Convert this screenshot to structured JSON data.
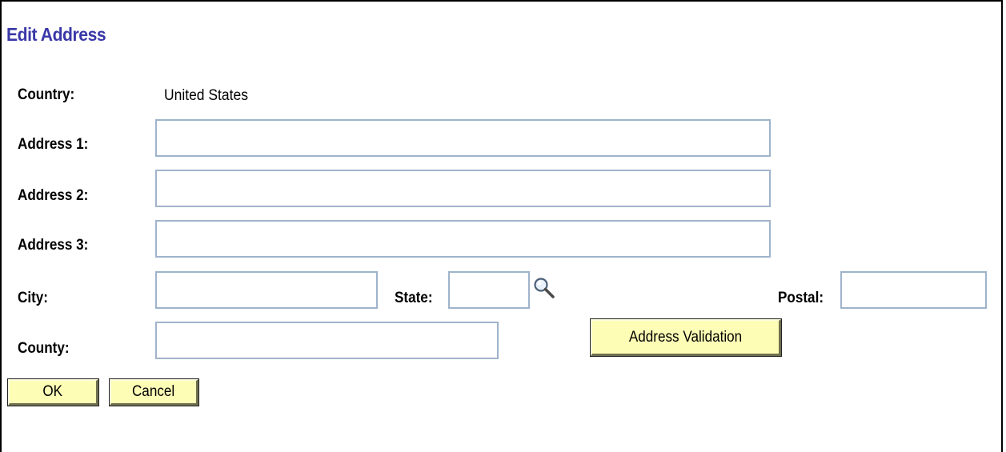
{
  "page": {
    "title": "Edit Address"
  },
  "form": {
    "country_label": "Country:",
    "country_value": "United States",
    "address1_label": "Address 1:",
    "address1_value": "",
    "address2_label": "Address 2:",
    "address2_value": "",
    "address3_label": "Address 3:",
    "address3_value": "",
    "city_label": "City:",
    "city_value": "",
    "state_label": "State:",
    "state_value": "",
    "postal_label": "Postal:",
    "postal_value": "",
    "county_label": "County:",
    "county_value": ""
  },
  "buttons": {
    "address_validation": "Address Validation",
    "ok": "OK",
    "cancel": "Cancel"
  },
  "icons": {
    "state_lookup": "magnifier-icon"
  },
  "colors": {
    "title": "#3a38a8",
    "field_border": "#9fb3cb",
    "button_bg": "#fdfdb6"
  }
}
